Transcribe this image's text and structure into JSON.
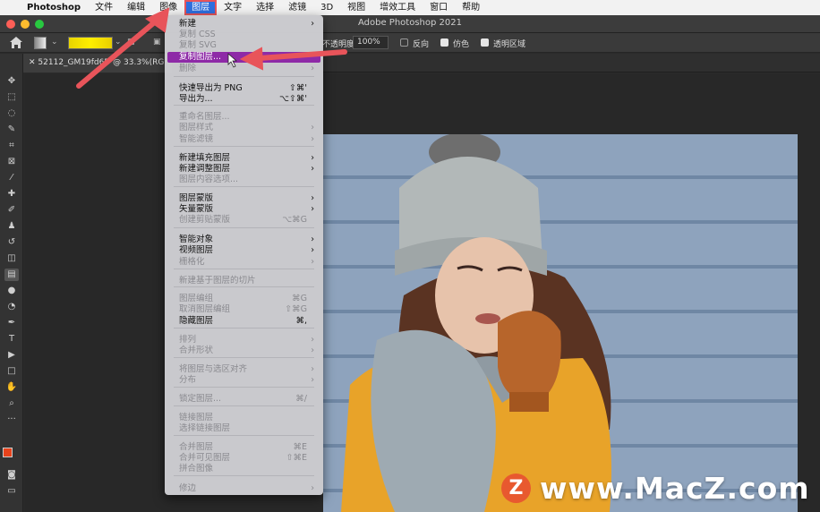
{
  "menubar": {
    "items": [
      "Photoshop",
      "文件",
      "编辑",
      "图像",
      "图层",
      "文字",
      "选择",
      "滤镜",
      "3D",
      "视图",
      "增效工具",
      "窗口",
      "帮助"
    ]
  },
  "window": {
    "title": "Adobe Photoshop 2021"
  },
  "options_bar": {
    "opacity_label": "不透明度:",
    "opacity_value": "100%",
    "reverse_label": "反向",
    "dither_label": "仿色",
    "transparency_label": "透明区域",
    "reverse_checked": false,
    "dither_checked": true,
    "transparency_checked": true
  },
  "document_tab": {
    "label": "52112_GM19fd6D",
    "zoom": "@ 33.3%(RG"
  },
  "layer_menu": {
    "items": [
      {
        "label": "新建",
        "shortcut": "",
        "submenu": true,
        "disabled": false
      },
      {
        "label": "复制 CSS",
        "shortcut": "",
        "submenu": false,
        "disabled": true
      },
      {
        "label": "复制 SVG",
        "shortcut": "",
        "submenu": false,
        "disabled": true
      },
      {
        "label": "复制图层...",
        "shortcut": "",
        "submenu": false,
        "disabled": false,
        "highlighted": true
      },
      {
        "label": "删除",
        "shortcut": "",
        "submenu": true,
        "disabled": true
      },
      {
        "label": "快速导出为 PNG",
        "shortcut": "⇧⌘'",
        "submenu": false,
        "disabled": false
      },
      {
        "label": "导出为...",
        "shortcut": "⌥⇧⌘'",
        "submenu": false,
        "disabled": false
      },
      {
        "label": "重命名图层...",
        "shortcut": "",
        "submenu": false,
        "disabled": true
      },
      {
        "label": "图层样式",
        "shortcut": "",
        "submenu": true,
        "disabled": true
      },
      {
        "label": "智能滤镜",
        "shortcut": "",
        "submenu": true,
        "disabled": true
      },
      {
        "label": "新建填充图层",
        "shortcut": "",
        "submenu": true,
        "disabled": false
      },
      {
        "label": "新建调整图层",
        "shortcut": "",
        "submenu": true,
        "disabled": false
      },
      {
        "label": "图层内容选项...",
        "shortcut": "",
        "submenu": false,
        "disabled": true
      },
      {
        "label": "图层蒙版",
        "shortcut": "",
        "submenu": true,
        "disabled": false
      },
      {
        "label": "矢量蒙版",
        "shortcut": "",
        "submenu": true,
        "disabled": false
      },
      {
        "label": "创建剪贴蒙版",
        "shortcut": "⌥⌘G",
        "submenu": false,
        "disabled": true
      },
      {
        "label": "智能对象",
        "shortcut": "",
        "submenu": true,
        "disabled": false
      },
      {
        "label": "视频图层",
        "shortcut": "",
        "submenu": true,
        "disabled": false
      },
      {
        "label": "栅格化",
        "shortcut": "",
        "submenu": true,
        "disabled": true
      },
      {
        "label": "新建基于图层的切片",
        "shortcut": "",
        "submenu": false,
        "disabled": true
      },
      {
        "label": "图层编组",
        "shortcut": "⌘G",
        "submenu": false,
        "disabled": true
      },
      {
        "label": "取消图层编组",
        "shortcut": "⇧⌘G",
        "submenu": false,
        "disabled": true
      },
      {
        "label": "隐藏图层",
        "shortcut": "⌘,",
        "submenu": false,
        "disabled": false
      },
      {
        "label": "排列",
        "shortcut": "",
        "submenu": true,
        "disabled": true
      },
      {
        "label": "合并形状",
        "shortcut": "",
        "submenu": true,
        "disabled": true
      },
      {
        "label": "将图层与选区对齐",
        "shortcut": "",
        "submenu": true,
        "disabled": true
      },
      {
        "label": "分布",
        "shortcut": "",
        "submenu": true,
        "disabled": true
      },
      {
        "label": "锁定图层...",
        "shortcut": "⌘/",
        "submenu": false,
        "disabled": true
      },
      {
        "label": "链接图层",
        "shortcut": "",
        "submenu": false,
        "disabled": true
      },
      {
        "label": "选择链接图层",
        "shortcut": "",
        "submenu": false,
        "disabled": true
      },
      {
        "label": "合并图层",
        "shortcut": "⌘E",
        "submenu": false,
        "disabled": true
      },
      {
        "label": "合并可见图层",
        "shortcut": "⇧⌘E",
        "submenu": false,
        "disabled": true
      },
      {
        "label": "拼合图像",
        "shortcut": "",
        "submenu": false,
        "disabled": true
      },
      {
        "label": "修边",
        "shortcut": "",
        "submenu": true,
        "disabled": true
      }
    ]
  },
  "watermark": {
    "letter": "Z",
    "text": "www.MacZ.com"
  },
  "colors": {
    "highlight": "#8e2aa7",
    "arrow": "#e8545a",
    "foreground_swatch": "#e8431c"
  }
}
